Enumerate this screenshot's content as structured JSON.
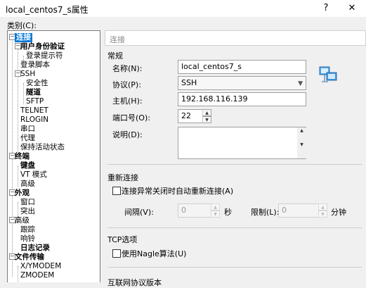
{
  "window": {
    "title": "local_centos7_s属性",
    "help": "?",
    "close": "✕"
  },
  "category_label": "类别(C):",
  "tree": [
    {
      "label": "连接",
      "bold": true,
      "selected": true
    },
    {
      "label": "用户身份验证",
      "bold": true
    },
    {
      "label": "登录提示符"
    },
    {
      "label": "登录脚本"
    },
    {
      "label": "SSH"
    },
    {
      "label": "安全性"
    },
    {
      "label": "隧道",
      "bold": true
    },
    {
      "label": "SFTP"
    },
    {
      "label": "TELNET"
    },
    {
      "label": "RLOGIN"
    },
    {
      "label": "串口"
    },
    {
      "label": "代理"
    },
    {
      "label": "保持活动状态"
    },
    {
      "label": "终端",
      "bold": true
    },
    {
      "label": "键盘",
      "bold": true
    },
    {
      "label": "VT 模式"
    },
    {
      "label": "高级"
    },
    {
      "label": "外观",
      "bold": true
    },
    {
      "label": "窗口"
    },
    {
      "label": "突出"
    },
    {
      "label": "高级"
    },
    {
      "label": "跟踪"
    },
    {
      "label": "响铃"
    },
    {
      "label": "日志记录",
      "bold": true
    },
    {
      "label": "文件传输",
      "bold": true
    },
    {
      "label": "X/YMODEM"
    },
    {
      "label": "ZMODEM"
    }
  ],
  "panel": {
    "header": "连接",
    "general": {
      "section": "常规",
      "name_label": "名称(N):",
      "name_value": "local_centos7_s",
      "protocol_label": "协议(P):",
      "protocol_value": "SSH",
      "host_label": "主机(H):",
      "host_value": "192.168.116.139",
      "port_label": "端口号(O):",
      "port_value": "22",
      "desc_label": "说明(D):",
      "desc_value": ""
    },
    "reconnect": {
      "section": "重新连接",
      "auto_label": "连接异常关闭时自动重新连接(A)",
      "interval_label": "间隔(V):",
      "interval_value": "0",
      "interval_unit": "秒",
      "limit_label": "限制(L):",
      "limit_value": "0",
      "limit_unit": "分钟"
    },
    "tcp": {
      "section": "TCP选项",
      "nagle_label": "使用Nagle算法(U)"
    },
    "protocol_section_partial": "互联网协议版本"
  },
  "colors": {
    "selection": "#0078d7",
    "window_bg": "#f0f0f0"
  }
}
